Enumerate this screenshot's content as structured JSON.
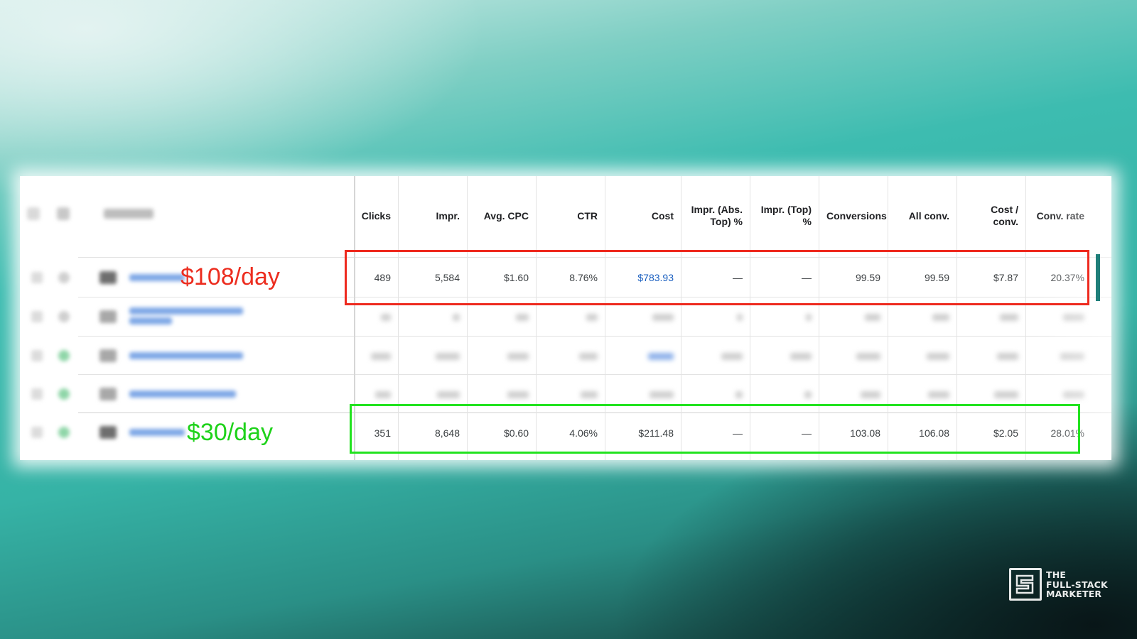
{
  "table": {
    "headers": [
      {
        "key": "clicks",
        "label": "Clicks"
      },
      {
        "key": "impr",
        "label": "Impr."
      },
      {
        "key": "avg_cpc",
        "label": "Avg. CPC"
      },
      {
        "key": "ctr",
        "label": "CTR"
      },
      {
        "key": "cost",
        "label": "Cost"
      },
      {
        "key": "impr_abs_top",
        "label": "Impr. (Abs. Top) %"
      },
      {
        "key": "impr_top",
        "label": "Impr. (Top) %"
      },
      {
        "key": "conversions",
        "label": "Conversions"
      },
      {
        "key": "all_conv",
        "label": "All conv."
      },
      {
        "key": "cost_conv",
        "label": "Cost / conv."
      },
      {
        "key": "conv_rate",
        "label": "Conv. rate"
      }
    ],
    "row_high": {
      "annotation": "$108/day",
      "cells": [
        "489",
        "5,584",
        "$1.60",
        "8.76%",
        "$783.93",
        "—",
        "—",
        "99.59",
        "99.59",
        "$7.87",
        "20.37%"
      ]
    },
    "row_low": {
      "annotation": "$30/day",
      "cells": [
        "351",
        "8,648",
        "$0.60",
        "4.06%",
        "$211.48",
        "—",
        "—",
        "103.08",
        "106.08",
        "$2.05",
        "28.01%"
      ]
    }
  },
  "logo": {
    "line1": "THE",
    "line2": "FULL-STACK",
    "line3": "MARKETER"
  },
  "colors": {
    "highlight_red": "#ee2a1f",
    "highlight_green": "#22e31f",
    "link": "#1a5fc0"
  }
}
